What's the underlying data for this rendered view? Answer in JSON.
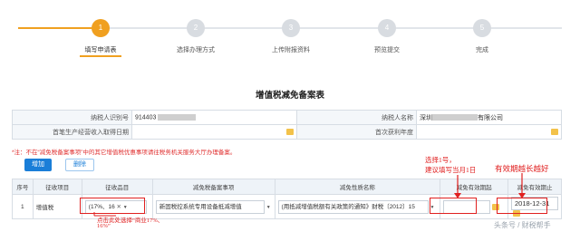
{
  "steps": [
    {
      "num": "1",
      "label": "填写申请表"
    },
    {
      "num": "2",
      "label": "选择办理方式"
    },
    {
      "num": "3",
      "label": "上传附报资料"
    },
    {
      "num": "4",
      "label": "预览提交"
    },
    {
      "num": "5",
      "label": "完成"
    }
  ],
  "form_title": "增值税减免备案表",
  "info": {
    "taxpayer_id_label": "纳税人识别号",
    "taxpayer_id_value": "914403",
    "taxpayer_name_label": "纳税人名称",
    "taxpayer_name_prefix": "深圳",
    "taxpayer_name_suffix": "有限公司",
    "first_income_label": "首笔生产经营收入取得日期",
    "first_profit_label": "首次获利年度"
  },
  "warning": "*注：不在“减免税备案事项”中的其它增值税优惠事项请往税务机关服务大厅办理备案。",
  "buttons": {
    "add": "增加",
    "delete": "删除"
  },
  "table": {
    "headers": [
      "序号",
      "征收项目",
      "征收品目",
      "减免税备案事项",
      "减免性质名称",
      "减免有效期起",
      "减免有效期止"
    ],
    "row": {
      "index": "1",
      "project": "增值税",
      "item": "(17%、16",
      "matter": "新固税控系统专用设备抵减增值",
      "nature": "(用抵减增值税额有关政策的通知》财税〔2012〕15",
      "start": "",
      "end": "2018-12-31"
    }
  },
  "annotations": {
    "start_note_1": "选择1号，",
    "start_note_2": "建议填写当月1日",
    "end_note": "有效期越长越好",
    "item_note_1": "点击此处选择“商业17%、",
    "item_note_2": "16%”"
  },
  "watermark": "头条号 / 财税帮手",
  "colors": {
    "accent": "#f0a020",
    "primary": "#1a7ed8",
    "alert": "#e02020"
  }
}
